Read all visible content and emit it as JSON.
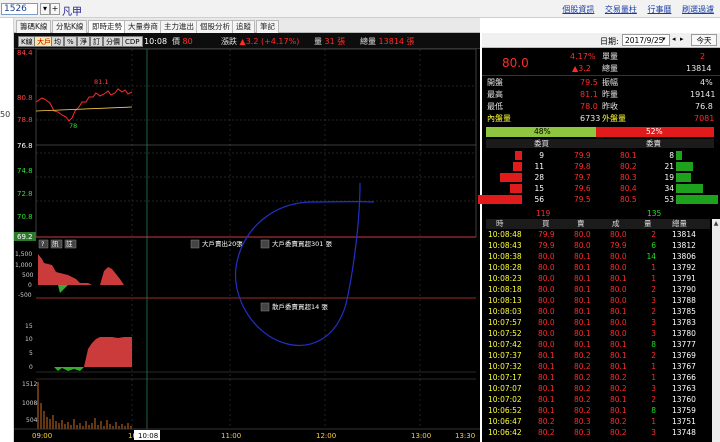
{
  "topbar": {
    "symbol": "1526",
    "plus": "+",
    "name": "凡甲",
    "links": [
      "個股資訊",
      "交易量柱",
      "行事曆",
      "刷選過濾"
    ]
  },
  "leftstrip": {
    "label": "50"
  },
  "tabs": [
    "籌碼K線",
    "分點K線",
    "即時走勢",
    "大量券商",
    "主力進出",
    "個股分析",
    "追蹤",
    "筆記"
  ],
  "toolbar": {
    "buttons": [
      "K線",
      "大戶",
      "均",
      "%",
      "淨",
      "訂",
      "分價",
      "CDP"
    ],
    "time": "10:08",
    "price_label": "價",
    "price_value": "80",
    "change_label": "漲跌",
    "change_value": "▲3.2 (+4.17%)",
    "volume_label": "量",
    "volume_value": "31 張",
    "total_label": "總量",
    "total_value": "13814 張"
  },
  "chart": {
    "price_ticks": [
      "84.4",
      "80.8",
      "78.8",
      "76.8",
      "74.8",
      "72.8",
      "70.8",
      "69.2"
    ],
    "inset_ticks": [
      "84.4",
      "80.8",
      "78.8"
    ],
    "inset_high_label": "81.1",
    "inset_low_label": "78",
    "annotations": [
      "大戶賣出20張",
      "大戶委賣買超301 張",
      "散戶委賣買超14 張"
    ],
    "panel_buttons": [
      "?",
      "訊",
      "註"
    ],
    "mid_ticks": [
      "1,500",
      "1,000",
      "500",
      "0",
      "-500"
    ],
    "ind_ticks": [
      "15",
      "10",
      "5",
      "0"
    ],
    "vol_ticks": [
      "1512",
      "1008",
      "504"
    ],
    "time_ticks": [
      "09:00",
      "10",
      "11:00",
      "12:00",
      "13:00",
      "13:30"
    ],
    "cursor_time": "10:08"
  },
  "rightpanel": {
    "date_label": "日期:",
    "date_value": "2017/9/25",
    "today_button": "今天",
    "price": "80.0",
    "pct": "4.17%",
    "chg": "▲3.2",
    "single_label": "單量",
    "single_value": "2",
    "total_label": "總量",
    "total_value": "13814",
    "stats": [
      {
        "label": "開盤",
        "value": "79.5",
        "label2": "振幅",
        "value2": "4%"
      },
      {
        "label": "最高",
        "value": "81.1",
        "label2": "昨量",
        "value2": "19141"
      },
      {
        "label": "最低",
        "value": "78.0",
        "label2": "昨收",
        "value2": "76.8"
      }
    ],
    "inner_label": "內盤量",
    "inner_value": "6733",
    "outer_label": "外盤量",
    "outer_value": "7081",
    "inner_pct": "48%",
    "outer_pct": "52%",
    "bid_head": "委買",
    "ask_head": "委賣",
    "orderbook": [
      {
        "bq": "9",
        "bp": "79.9",
        "ap": "80.1",
        "aq": "8"
      },
      {
        "bq": "11",
        "bp": "79.8",
        "ap": "80.2",
        "aq": "21"
      },
      {
        "bq": "28",
        "bp": "79.7",
        "ap": "80.3",
        "aq": "19"
      },
      {
        "bq": "15",
        "bp": "79.6",
        "ap": "80.4",
        "aq": "34"
      },
      {
        "bq": "56",
        "bp": "79.5",
        "ap": "80.5",
        "aq": "53"
      }
    ],
    "sum_bid": "119",
    "sum_ask": "135",
    "tick_head": [
      "時",
      "買",
      "賣",
      "成",
      "量",
      "總量"
    ],
    "ticks": [
      {
        "t": "10:08:48",
        "b": "79.9",
        "s": "80.0",
        "p": "80.0",
        "v": "2",
        "tot": "13814"
      },
      {
        "t": "10:08:43",
        "b": "79.9",
        "s": "80.0",
        "p": "79.9",
        "v": "6",
        "tot": "13812"
      },
      {
        "t": "10:08:38",
        "b": "80.0",
        "s": "80.1",
        "p": "80.0",
        "v": "14",
        "tot": "13806"
      },
      {
        "t": "10:08:28",
        "b": "80.0",
        "s": "80.1",
        "p": "80.0",
        "v": "1",
        "tot": "13792"
      },
      {
        "t": "10:08:23",
        "b": "80.0",
        "s": "80.1",
        "p": "80.1",
        "v": "1",
        "tot": "13791"
      },
      {
        "t": "10:08:18",
        "b": "80.0",
        "s": "80.1",
        "p": "80.0",
        "v": "2",
        "tot": "13790"
      },
      {
        "t": "10:08:13",
        "b": "80.0",
        "s": "80.1",
        "p": "80.0",
        "v": "3",
        "tot": "13788"
      },
      {
        "t": "10:08:03",
        "b": "80.0",
        "s": "80.1",
        "p": "80.1",
        "v": "2",
        "tot": "13785"
      },
      {
        "t": "10:07:57",
        "b": "80.0",
        "s": "80.1",
        "p": "80.0",
        "v": "3",
        "tot": "13783"
      },
      {
        "t": "10:07:52",
        "b": "80.0",
        "s": "80.1",
        "p": "80.0",
        "v": "3",
        "tot": "13780"
      },
      {
        "t": "10:07:42",
        "b": "80.0",
        "s": "80.1",
        "p": "80.1",
        "v": "8",
        "tot": "13777"
      },
      {
        "t": "10:07:37",
        "b": "80.1",
        "s": "80.2",
        "p": "80.1",
        "v": "2",
        "tot": "13769"
      },
      {
        "t": "10:07:32",
        "b": "80.1",
        "s": "80.2",
        "p": "80.1",
        "v": "1",
        "tot": "13767"
      },
      {
        "t": "10:07:17",
        "b": "80.1",
        "s": "80.2",
        "p": "80.2",
        "v": "1",
        "tot": "13766"
      },
      {
        "t": "10:07:07",
        "b": "80.1",
        "s": "80.2",
        "p": "80.2",
        "v": "3",
        "tot": "13763"
      },
      {
        "t": "10:07:02",
        "b": "80.1",
        "s": "80.2",
        "p": "80.1",
        "v": "2",
        "tot": "13760"
      },
      {
        "t": "10:06:52",
        "b": "80.1",
        "s": "80.2",
        "p": "80.1",
        "v": "8",
        "tot": "13759"
      },
      {
        "t": "10:06:47",
        "b": "80.2",
        "s": "80.3",
        "p": "80.2",
        "v": "1",
        "tot": "13751"
      },
      {
        "t": "10:06:42",
        "b": "80.2",
        "s": "80.3",
        "p": "80.2",
        "v": "3",
        "tot": "13748"
      }
    ]
  }
}
